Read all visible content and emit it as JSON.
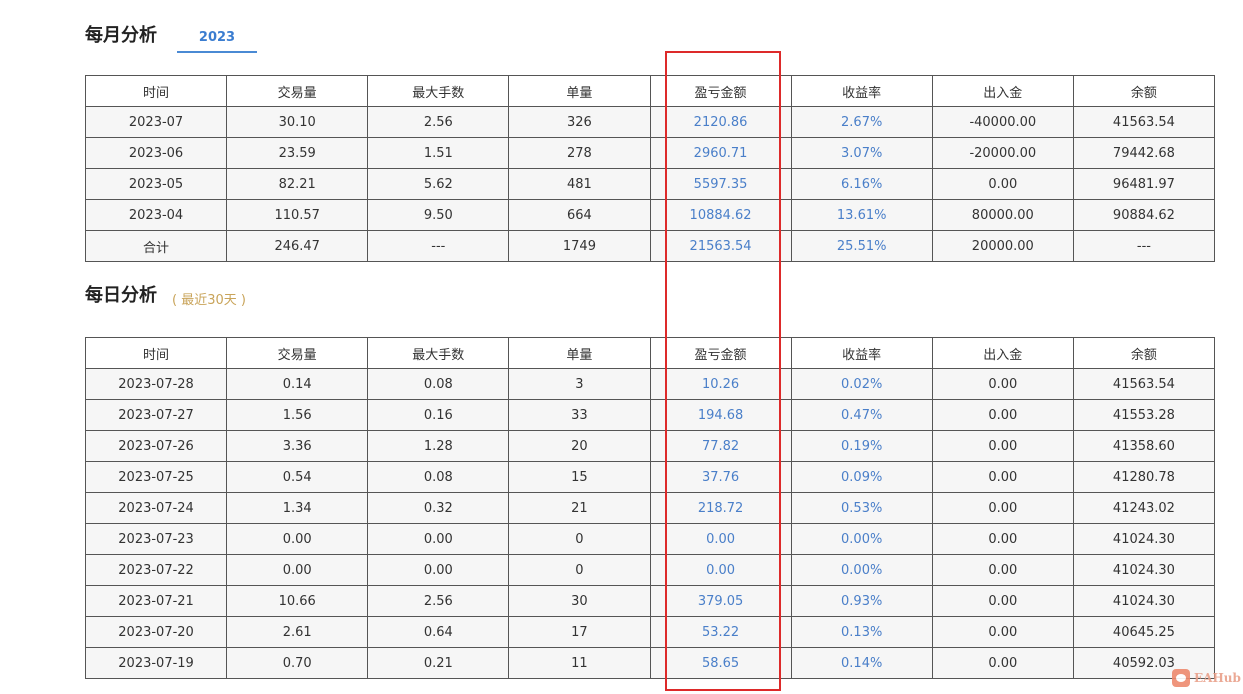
{
  "monthly": {
    "title": "每月分析",
    "year_tab": "2023",
    "headers": [
      "时间",
      "交易量",
      "最大手数",
      "单量",
      "盈亏金额",
      "收益率",
      "出入金",
      "余额"
    ],
    "rows": [
      [
        "2023-07",
        "30.10",
        "2.56",
        "326",
        "2120.86",
        "2.67%",
        "-40000.00",
        "41563.54"
      ],
      [
        "2023-06",
        "23.59",
        "1.51",
        "278",
        "2960.71",
        "3.07%",
        "-20000.00",
        "79442.68"
      ],
      [
        "2023-05",
        "82.21",
        "5.62",
        "481",
        "5597.35",
        "6.16%",
        "0.00",
        "96481.97"
      ],
      [
        "2023-04",
        "110.57",
        "9.50",
        "664",
        "10884.62",
        "13.61%",
        "80000.00",
        "90884.62"
      ],
      [
        "合计",
        "246.47",
        "---",
        "1749",
        "21563.54",
        "25.51%",
        "20000.00",
        "---"
      ]
    ]
  },
  "daily": {
    "title": "每日分析",
    "hint": "( 最近30天 )",
    "headers": [
      "时间",
      "交易量",
      "最大手数",
      "单量",
      "盈亏金额",
      "收益率",
      "出入金",
      "余额"
    ],
    "rows": [
      [
        "2023-07-28",
        "0.14",
        "0.08",
        "3",
        "10.26",
        "0.02%",
        "0.00",
        "41563.54"
      ],
      [
        "2023-07-27",
        "1.56",
        "0.16",
        "33",
        "194.68",
        "0.47%",
        "0.00",
        "41553.28"
      ],
      [
        "2023-07-26",
        "3.36",
        "1.28",
        "20",
        "77.82",
        "0.19%",
        "0.00",
        "41358.60"
      ],
      [
        "2023-07-25",
        "0.54",
        "0.08",
        "15",
        "37.76",
        "0.09%",
        "0.00",
        "41280.78"
      ],
      [
        "2023-07-24",
        "1.34",
        "0.32",
        "21",
        "218.72",
        "0.53%",
        "0.00",
        "41243.02"
      ],
      [
        "2023-07-23",
        "0.00",
        "0.00",
        "0",
        "0.00",
        "0.00%",
        "0.00",
        "41024.30"
      ],
      [
        "2023-07-22",
        "0.00",
        "0.00",
        "0",
        "0.00",
        "0.00%",
        "0.00",
        "41024.30"
      ],
      [
        "2023-07-21",
        "10.66",
        "2.56",
        "30",
        "379.05",
        "0.93%",
        "0.00",
        "41024.30"
      ],
      [
        "2023-07-20",
        "2.61",
        "0.64",
        "17",
        "53.22",
        "0.13%",
        "0.00",
        "40645.25"
      ],
      [
        "2023-07-19",
        "0.70",
        "0.21",
        "11",
        "58.65",
        "0.14%",
        "0.00",
        "40592.03"
      ]
    ]
  },
  "watermark": {
    "text": "EAHub"
  },
  "colors": {
    "accent": "#4a7fc9",
    "highlight": "#dd2a2a",
    "hint": "#c9a45a"
  }
}
